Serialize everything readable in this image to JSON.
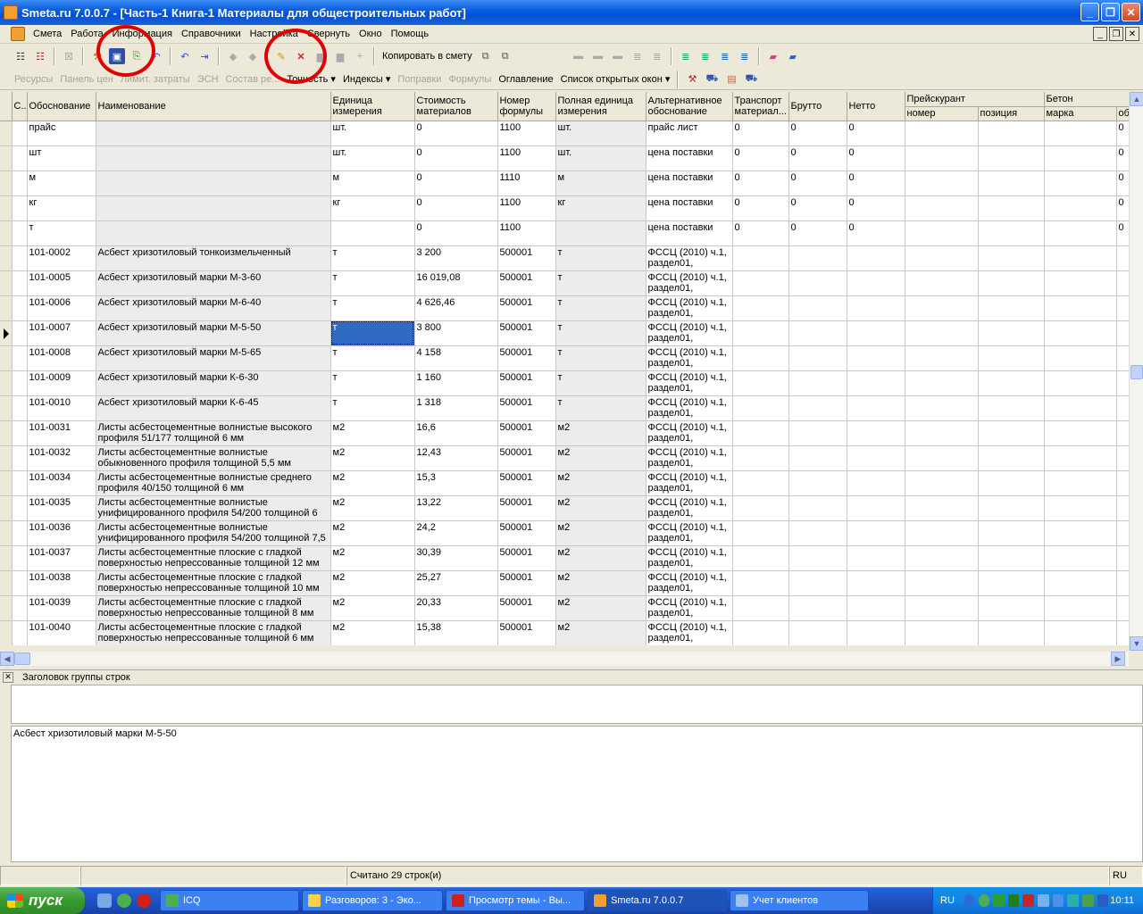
{
  "window": {
    "title": "Smeta.ru  7.0.0.7  - [Часть-1 Книга-1 Материалы для общестроительных работ]",
    "minimize": "_",
    "maximize": "❐",
    "close": "✕"
  },
  "menu": {
    "items": [
      "Смета",
      "Работа",
      "Информация",
      "Справочники",
      "Настройка",
      "Свернуть",
      "Окно",
      "Помощь"
    ],
    "mdi_minimize": "_",
    "mdi_restore": "❐",
    "mdi_close": "✕"
  },
  "toolbar1": {
    "copy_to_estimate": "Копировать в смету"
  },
  "toolbar2": {
    "resources": "Ресурсы",
    "price_panel": "Панель цен",
    "limit_costs": "Лимит. затраты",
    "esn": "ЭСН",
    "composition": "Состав ре...",
    "accuracy": "Точность",
    "indexes": "Индексы",
    "corrections": "Поправки",
    "formulas": "Формулы",
    "contents": "Оглавление",
    "open_windows": "Список открытых окон"
  },
  "grid": {
    "headers": {
      "c": "С...",
      "basis": "Обоснование",
      "name": "Наименование",
      "unit": "Единица измерения",
      "cost": "Стоимость материалов",
      "formula": "Номер формулы",
      "full_unit": "Полная единица измерения",
      "alt_basis": "Альтернативное обоснование",
      "transport": "Транспорт материал...",
      "gross": "Брутто",
      "net": "Нетто",
      "pricelist": "Прейскурант",
      "pl_number": "номер",
      "pl_position": "позиция",
      "concrete": "Бетон",
      "concrete_mark": "марка",
      "last_col": "об"
    },
    "rows": [
      {
        "basis": "прайс",
        "name": "",
        "unit": "шт.",
        "cost": "0",
        "formula": "1100",
        "full_unit": "шт.",
        "alt": "прайс лист",
        "transport": "0",
        "gross": "0",
        "net": "0",
        "last": "0"
      },
      {
        "basis": "шт",
        "name": "",
        "unit": "шт.",
        "cost": "0",
        "formula": "1100",
        "full_unit": "шт.",
        "alt": "цена поставки",
        "transport": "0",
        "gross": "0",
        "net": "0",
        "last": "0"
      },
      {
        "basis": "м",
        "name": "",
        "unit": "м",
        "cost": "0",
        "formula": "1110",
        "full_unit": "м",
        "alt": "цена поставки",
        "transport": "0",
        "gross": "0",
        "net": "0",
        "last": "0"
      },
      {
        "basis": "кг",
        "name": "",
        "unit": "кг",
        "cost": "0",
        "formula": "1100",
        "full_unit": "кг",
        "alt": "цена поставки",
        "transport": "0",
        "gross": "0",
        "net": "0",
        "last": "0"
      },
      {
        "basis": "т",
        "name": "",
        "unit": "",
        "cost": "0",
        "formula": "1100",
        "full_unit": "",
        "alt": "цена поставки",
        "transport": "0",
        "gross": "0",
        "net": "0",
        "last": "0"
      },
      {
        "basis": "101-0002",
        "name": "Асбест хризотиловый тонкоизмельченный",
        "unit": "т",
        "cost": "3 200",
        "formula": "500001",
        "full_unit": "т",
        "alt": "ФССЦ (2010) ч.1, раздел01,",
        "transport": "",
        "gross": "",
        "net": "",
        "last": ""
      },
      {
        "basis": "101-0005",
        "name": "Асбест хризотиловый марки М-3-60",
        "unit": "т",
        "cost": "16 019,08",
        "formula": "500001",
        "full_unit": "т",
        "alt": "ФССЦ (2010) ч.1, раздел01,",
        "transport": "",
        "gross": "",
        "net": "",
        "last": ""
      },
      {
        "basis": "101-0006",
        "name": "Асбест хризотиловый марки М-6-40",
        "unit": "т",
        "cost": "4 626,46",
        "formula": "500001",
        "full_unit": "т",
        "alt": "ФССЦ (2010) ч.1, раздел01,",
        "transport": "",
        "gross": "",
        "net": "",
        "last": ""
      },
      {
        "basis": "101-0007",
        "name": "Асбест хризотиловый марки М-5-50",
        "unit": "т",
        "cost": "3 800",
        "formula": "500001",
        "full_unit": "т",
        "alt": "ФССЦ (2010) ч.1, раздел01,",
        "transport": "",
        "gross": "",
        "net": "",
        "last": ""
      },
      {
        "basis": "101-0008",
        "name": "Асбест хризотиловый марки М-5-65",
        "unit": "т",
        "cost": "4 158",
        "formula": "500001",
        "full_unit": "т",
        "alt": "ФССЦ (2010) ч.1, раздел01,",
        "transport": "",
        "gross": "",
        "net": "",
        "last": ""
      },
      {
        "basis": "101-0009",
        "name": "Асбест хризотиловый марки К-6-30",
        "unit": "т",
        "cost": "1 160",
        "formula": "500001",
        "full_unit": "т",
        "alt": "ФССЦ (2010) ч.1, раздел01,",
        "transport": "",
        "gross": "",
        "net": "",
        "last": ""
      },
      {
        "basis": "101-0010",
        "name": "Асбест хризотиловый марки К-6-45",
        "unit": "т",
        "cost": "1 318",
        "formula": "500001",
        "full_unit": "т",
        "alt": "ФССЦ (2010) ч.1, раздел01,",
        "transport": "",
        "gross": "",
        "net": "",
        "last": ""
      },
      {
        "basis": "101-0031",
        "name": "Листы асбестоцементные волнистые высокого профиля 51/177 толщиной 6 мм",
        "unit": "м2",
        "cost": "16,6",
        "formula": "500001",
        "full_unit": "м2",
        "alt": "ФССЦ (2010) ч.1, раздел01,",
        "transport": "",
        "gross": "",
        "net": "",
        "last": ""
      },
      {
        "basis": "101-0032",
        "name": "Листы асбестоцементные волнистые обыкновенного профиля толщиной 5,5 мм",
        "unit": "м2",
        "cost": "12,43",
        "formula": "500001",
        "full_unit": "м2",
        "alt": "ФССЦ (2010) ч.1, раздел01,",
        "transport": "",
        "gross": "",
        "net": "",
        "last": ""
      },
      {
        "basis": "101-0034",
        "name": "Листы асбестоцементные волнистые среднего профиля 40/150 толщиной 6 мм",
        "unit": "м2",
        "cost": "15,3",
        "formula": "500001",
        "full_unit": "м2",
        "alt": "ФССЦ (2010) ч.1, раздел01,",
        "transport": "",
        "gross": "",
        "net": "",
        "last": ""
      },
      {
        "basis": "101-0035",
        "name": "Листы асбестоцементные волнистые унифицированного профиля 54/200 толщиной 6",
        "unit": "м2",
        "cost": "13,22",
        "formula": "500001",
        "full_unit": "м2",
        "alt": "ФССЦ (2010) ч.1, раздел01,",
        "transport": "",
        "gross": "",
        "net": "",
        "last": ""
      },
      {
        "basis": "101-0036",
        "name": "Листы асбестоцементные волнистые унифицированного профиля 54/200 толщиной 7,5",
        "unit": "м2",
        "cost": "24,2",
        "formula": "500001",
        "full_unit": "м2",
        "alt": "ФССЦ (2010) ч.1, раздел01,",
        "transport": "",
        "gross": "",
        "net": "",
        "last": ""
      },
      {
        "basis": "101-0037",
        "name": "Листы асбестоцементные плоские с гладкой поверхностью непрессованные толщиной 12 мм",
        "unit": "м2",
        "cost": "30,39",
        "formula": "500001",
        "full_unit": "м2",
        "alt": "ФССЦ (2010) ч.1, раздел01,",
        "transport": "",
        "gross": "",
        "net": "",
        "last": ""
      },
      {
        "basis": "101-0038",
        "name": "Листы асбестоцементные плоские с гладкой поверхностью непрессованные толщиной 10 мм",
        "unit": "м2",
        "cost": "25,27",
        "formula": "500001",
        "full_unit": "м2",
        "alt": "ФССЦ (2010) ч.1, раздел01,",
        "transport": "",
        "gross": "",
        "net": "",
        "last": ""
      },
      {
        "basis": "101-0039",
        "name": "Листы асбестоцементные плоские с гладкой поверхностью непрессованные толщиной 8 мм",
        "unit": "м2",
        "cost": "20,33",
        "formula": "500001",
        "full_unit": "м2",
        "alt": "ФССЦ (2010) ч.1, раздел01,",
        "transport": "",
        "gross": "",
        "net": "",
        "last": ""
      },
      {
        "basis": "101-0040",
        "name": "Листы асбестоцементные плоские с гладкой поверхностью непрессованные толщиной 6 мм",
        "unit": "м2",
        "cost": "15,38",
        "formula": "500001",
        "full_unit": "м2",
        "alt": "ФССЦ (2010) ч.1, раздел01,",
        "transport": "",
        "gross": "",
        "net": "",
        "last": ""
      }
    ],
    "selected_row": 8
  },
  "group_header": "Заголовок группы строк",
  "detail_text": "Асбест хризотиловый марки М-5-50",
  "status": {
    "rows_count": "Считано 29 строк(и)",
    "lang": "RU"
  },
  "taskbar": {
    "start": "пуск",
    "tasks": [
      {
        "label": "ICQ",
        "color": "#4caf50"
      },
      {
        "label": "Разговоров: 3 - Эко...",
        "color": "#f7d24a"
      },
      {
        "label": "Просмотр темы - Вы...",
        "color": "#d0201b"
      },
      {
        "label": "Smeta.ru  7.0.0.7",
        "color": "#f0a030"
      },
      {
        "label": "Учет клиентов",
        "color": "#9ec1f0"
      }
    ],
    "lang": "RU",
    "clock": "10:11"
  },
  "colors": {
    "selection": "#316ac5",
    "annotation_circle": "#e00000"
  }
}
